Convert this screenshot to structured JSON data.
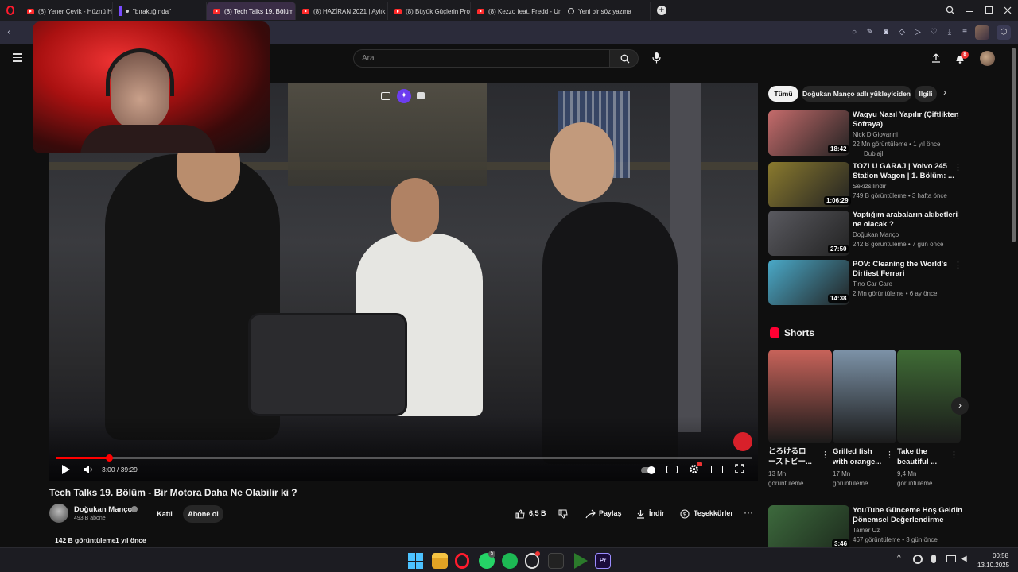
{
  "browser": {
    "tabs": [
      {
        "label": "(8) Yener Çevik - Hüznü H",
        "type": "youtube"
      },
      {
        "label": "\"bıraktığında\"",
        "type": "other"
      },
      {
        "label": "(8) Tech Talks 19. Bölüm",
        "type": "youtube",
        "active": true
      },
      {
        "label": "(8) HAZİRAN 2021 | Aylık",
        "type": "youtube"
      },
      {
        "label": "(8) Büyük Güçlerin Propag",
        "type": "youtube"
      },
      {
        "label": "(8) Kezzo feat. Fredd - Um",
        "type": "youtube"
      },
      {
        "label": "Yeni bir söz yazma",
        "type": "genius"
      }
    ],
    "new_tab": "+",
    "window_controls": [
      "search-icon",
      "minimize-icon",
      "restore-icon",
      "close-icon"
    ]
  },
  "youtube": {
    "search_placeholder": "Ara",
    "notification_count": "8",
    "video": {
      "time": "3:00 / 39:29",
      "progress": 0.076,
      "title": "Tech Talks 19. Bölüm - Bir Motora Daha Ne Olabilir ki ?",
      "channel": "Doğukan Manço",
      "subscribers": "493 B abone",
      "join": "Katıl",
      "subscribe": "Abone ol",
      "likes": "6,5 B",
      "share": "Paylaş",
      "download": "İndir",
      "thanks": "Teşekkürler",
      "views": "142 B görüntüleme",
      "age": "1 yıl önce"
    },
    "chips": [
      "Tümü",
      "Doğukan Manço adlı yükleyiciden",
      "İlgili"
    ],
    "recommendations": [
      {
        "title_1": "Wagyu Nasıl Yapılır (Çiftlikten",
        "title_2": "Sofraya)",
        "channel": "Nick DiGiovanni",
        "stats": "22 Mn görüntüleme • 1 yıl önce",
        "extra": "Dublajlı",
        "duration": "18:42",
        "thumb_color": "#c46b6b"
      },
      {
        "title_1": "TOZLU GARAJ | Volvo 245",
        "title_2": "Station Wagon | 1. Bölüm: ...",
        "channel": "Sekizsilindir",
        "stats": "749 B görüntüleme • 3 hafta önce",
        "extra": "",
        "duration": "1:06:29",
        "thumb_color": "#8a7a2e"
      },
      {
        "title_1": "Yaptığım arabaların akıbetleri",
        "title_2": "ne olacak ?",
        "channel": "Doğukan Manço",
        "stats": "242 B görüntüleme • 7 gün önce",
        "extra": "",
        "duration": "27:50",
        "thumb_color": "#5a5a60"
      },
      {
        "title_1": "POV: Cleaning the World's",
        "title_2": "Dirtiest Ferrari",
        "channel": "Tino Car Care",
        "stats": "2 Mn görüntüleme • 6 ay önce",
        "extra": "",
        "duration": "14:38",
        "thumb_color": "#4aa9c8"
      }
    ],
    "shorts_header": "Shorts",
    "shorts": [
      {
        "title_1": "とろけるロ",
        "title_2": "ーストビー...",
        "views_1": "13 Mn",
        "views_2": "görüntüleme",
        "thumb_color": "#c8635a"
      },
      {
        "title_1": "Grilled fish",
        "title_2": "with orange...",
        "views_1": "17 Mn",
        "views_2": "görüntüleme",
        "thumb_color": "#7d93a8"
      },
      {
        "title_1": "Take the",
        "title_2": "beautiful ...",
        "views_1": "9,4 Mn",
        "views_2": "görüntüleme",
        "thumb_color": "#3f6b35"
      }
    ],
    "bottom_rec": {
      "title_1": "YouTube Günceme Hoş Geldin |",
      "title_2": "Dönemsel Değerlendirme",
      "channel": "Tamer Uz",
      "stats": "467 görüntüleme • 3 gün önce",
      "duration": "3:46",
      "thumb_color": "#3d6a3d"
    }
  },
  "taskbar": {
    "time": "00:58",
    "date": "13.10.2025",
    "whatsapp_badge": "5"
  }
}
